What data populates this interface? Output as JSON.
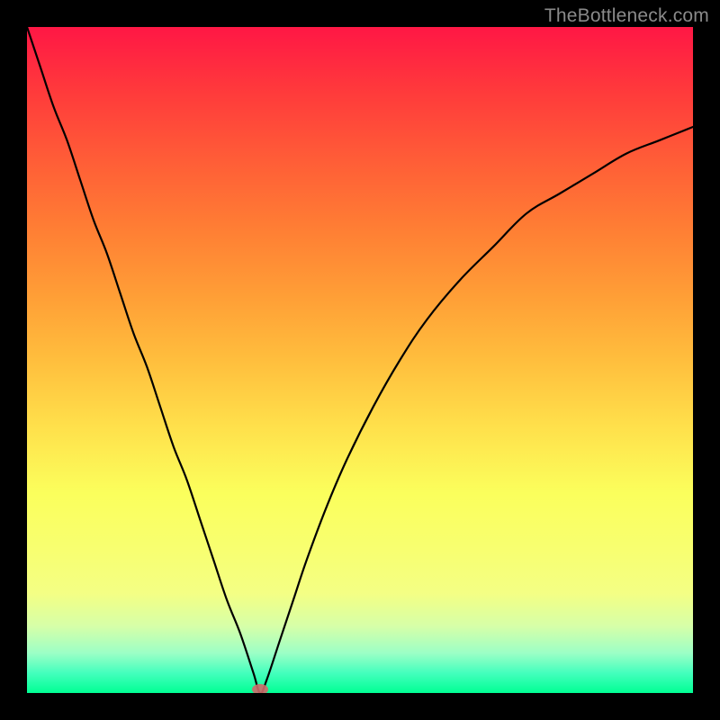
{
  "watermark": "TheBottleneck.com",
  "chart_data": {
    "type": "line",
    "title": "",
    "xlabel": "",
    "ylabel": "",
    "xlim": [
      0,
      100
    ],
    "ylim": [
      0,
      100
    ],
    "grid": false,
    "legend": false,
    "background": {
      "gradient_direction": "vertical",
      "stops": [
        {
          "pos": 0,
          "y": 100,
          "color": "#ff1745",
          "meaning": "high"
        },
        {
          "pos": 50,
          "y": 50,
          "color": "#ffbe3d",
          "meaning": "mid"
        },
        {
          "pos": 100,
          "y": 0,
          "color": "#00ff94",
          "meaning": "low"
        }
      ]
    },
    "series": [
      {
        "name": "bottleneck-curve",
        "color": "#000000",
        "x": [
          0,
          2,
          4,
          6,
          8,
          10,
          12,
          14,
          16,
          18,
          20,
          22,
          24,
          26,
          28,
          30,
          32,
          34,
          35,
          36,
          38,
          40,
          42,
          45,
          48,
          52,
          56,
          60,
          65,
          70,
          75,
          80,
          85,
          90,
          95,
          100
        ],
        "y": [
          100,
          94,
          88,
          83,
          77,
          71,
          66,
          60,
          54,
          49,
          43,
          37,
          32,
          26,
          20,
          14,
          9,
          3,
          0,
          2,
          8,
          14,
          20,
          28,
          35,
          43,
          50,
          56,
          62,
          67,
          72,
          75,
          78,
          81,
          83,
          85
        ]
      }
    ],
    "markers": [
      {
        "name": "min-marker",
        "x": 35,
        "y": 0,
        "color": "#d06a6a",
        "shape": "ellipse"
      }
    ],
    "min_point": {
      "x": 35,
      "y": 0
    }
  }
}
